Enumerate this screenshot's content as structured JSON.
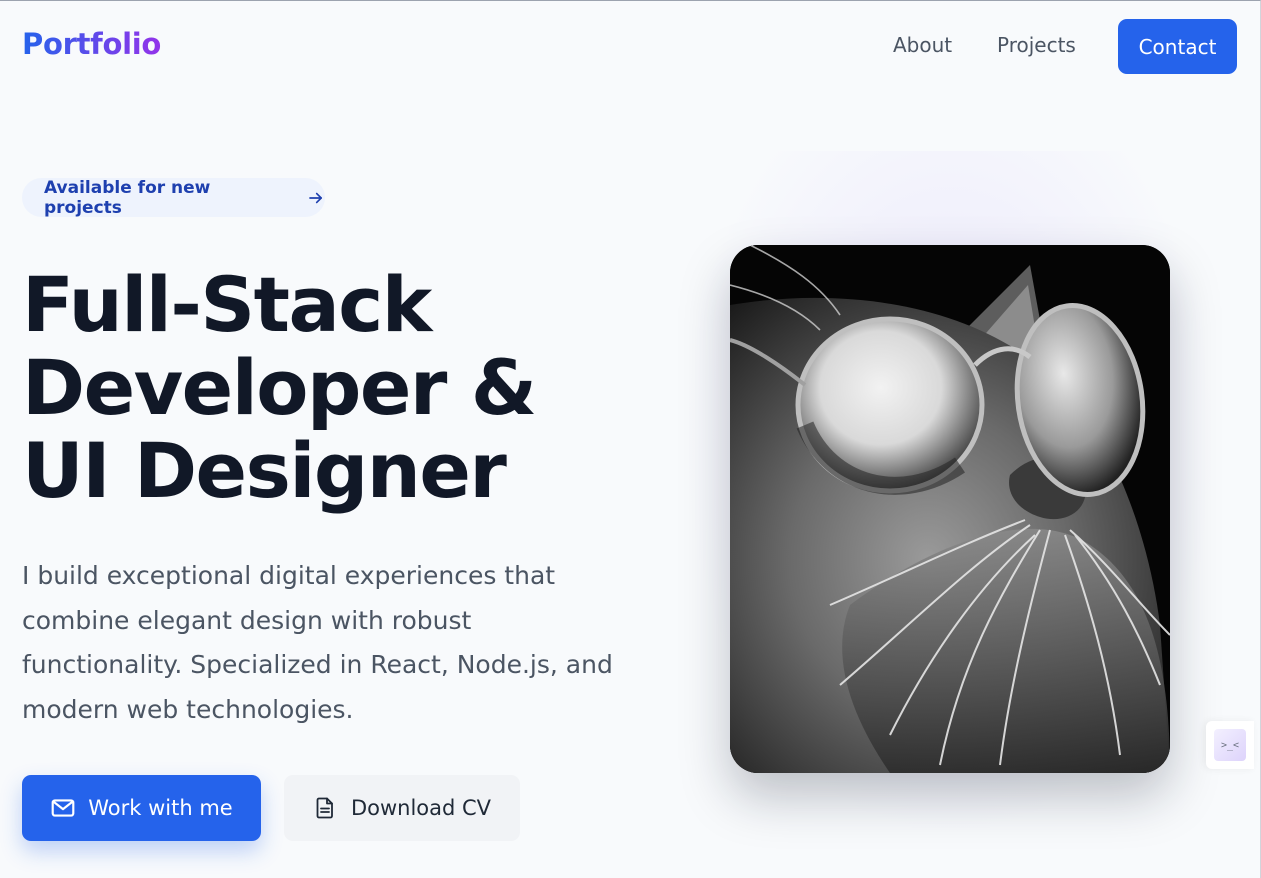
{
  "nav": {
    "logo": "Portfolio",
    "links": [
      {
        "label": "About"
      },
      {
        "label": "Projects"
      }
    ],
    "contact_label": "Contact"
  },
  "hero": {
    "badge": "Available for new projects",
    "title_lines": [
      "Full-Stack",
      "Developer &",
      "UI Designer"
    ],
    "description_lines": [
      "I build exceptional digital experiences that",
      "combine elegant design with robust",
      "functionality. Specialized in React, Node.js, and",
      "modern web technologies."
    ],
    "primary_button": "Work with me",
    "secondary_button": "Download CV",
    "image_subject": "black-and-white cat wearing round sunglasses"
  },
  "widget": {
    "glyph": ">_<"
  },
  "colors": {
    "accent": "#2563eb",
    "logo_gradient_end": "#9333ea",
    "heading": "#111827",
    "body_text": "#4b5563",
    "badge_bg": "#eef3fd",
    "badge_text": "#1e40af"
  },
  "icons": {
    "badge": "arrow-right-icon",
    "primary_button": "mail-icon",
    "secondary_button": "document-icon"
  }
}
